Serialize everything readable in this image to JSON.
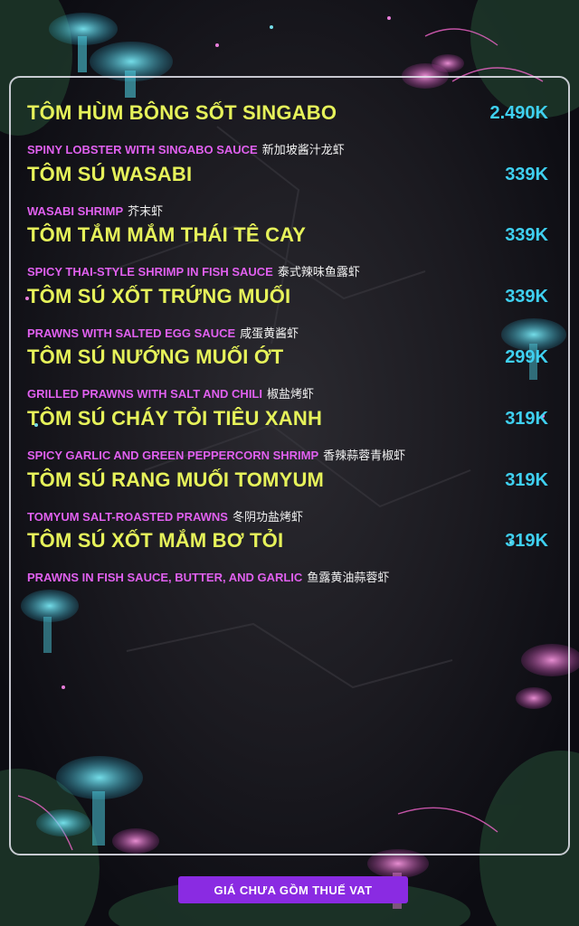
{
  "menu": {
    "items": [
      {
        "name_vi": "TÔM HÙM BÔNG SỐT SINGABO",
        "name_en": "SPINY LOBSTER WITH SINGABO SAUCE",
        "name_zh": "新加坡酱汁龙虾",
        "price": "2.490K"
      },
      {
        "name_vi": "TÔM SÚ WASABI",
        "name_en": "WASABI SHRIMP",
        "name_zh": "芥末虾",
        "price": "339K"
      },
      {
        "name_vi": "TÔM TẮM MẮM THÁI TÊ CAY",
        "name_en": "SPICY THAI-STYLE SHRIMP IN FISH SAUCE",
        "name_zh": "泰式辣味鱼露虾",
        "price": "339K"
      },
      {
        "name_vi": "TÔM SÚ XỐT TRỨNG MUỐI",
        "name_en": "PRAWNS WITH SALTED EGG SAUCE",
        "name_zh": "咸蛋黄酱虾",
        "price": "339K"
      },
      {
        "name_vi": "TÔM SÚ NƯỚNG MUỐI ỚT",
        "name_en": "GRILLED PRAWNS WITH SALT AND CHILI",
        "name_zh": "椒盐烤虾",
        "price": "299K"
      },
      {
        "name_vi": "TÔM SÚ CHÁY TỎI TIÊU XANH",
        "name_en": "SPICY GARLIC AND GREEN PEPPERCORN SHRIMP",
        "name_zh": "香辣蒜蓉青椒虾",
        "price": "319K"
      },
      {
        "name_vi": "TÔM SÚ RANG MUỐI TOMYUM",
        "name_en": "TOMYUM SALT-ROASTED PRAWNS",
        "name_zh": "冬阴功盐烤虾",
        "price": "319K"
      },
      {
        "name_vi": "TÔM SÚ XỐT MẮM BƠ TỎI",
        "name_en": "PRAWNS IN FISH SAUCE, BUTTER, AND GARLIC",
        "name_zh": "鱼露黄油蒜蓉虾",
        "price": "319K"
      }
    ]
  },
  "footer": {
    "vat_note": "GIÁ CHƯA GỒM THUẾ VAT"
  },
  "colors": {
    "name_vi": "#e6f25a",
    "name_en": "#e060ef",
    "price": "#3fd0f0",
    "vat_badge": "#8a2be2"
  },
  "decor": [
    "mushroom-icon",
    "leaf-icon"
  ]
}
